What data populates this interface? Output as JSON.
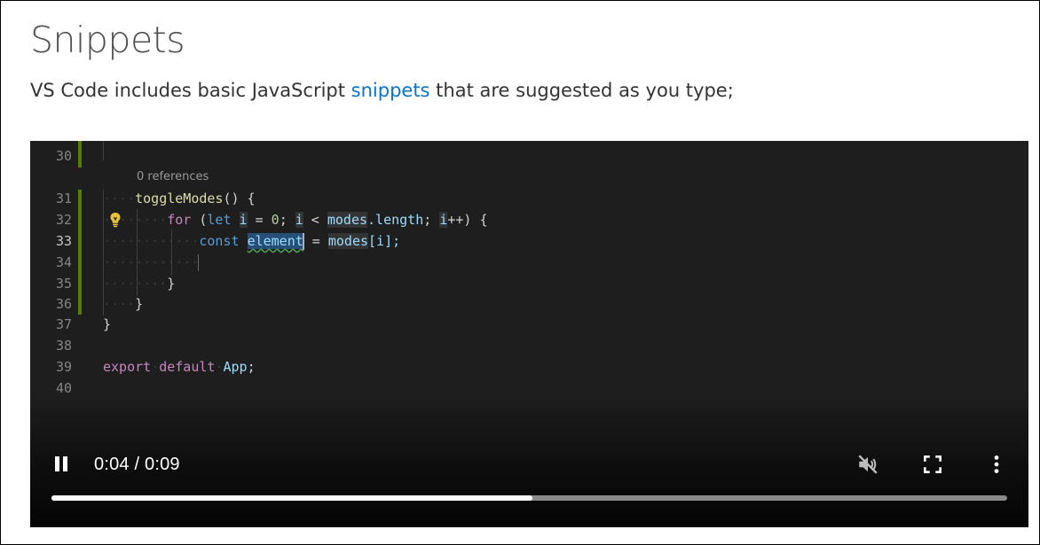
{
  "page": {
    "title": "Snippets",
    "intro_before": "VS Code includes basic JavaScript ",
    "intro_link": "snippets",
    "intro_after": " that are suggested as you type;"
  },
  "editor": {
    "codelens": "0 references",
    "line_numbers": [
      "30",
      "31",
      "32",
      "33",
      "34",
      "35",
      "36",
      "37",
      "38",
      "39",
      "40"
    ],
    "code": {
      "l31_fn": "toggleModes",
      "l31_rest": "() {",
      "l32_for": "for",
      "l32_let": "let",
      "l32_i1": "i",
      "l32_eq": " = ",
      "l32_zero": "0",
      "l32_semi1": "; ",
      "l32_i2": "i",
      "l32_lt": " < ",
      "l32_modes": "modes",
      "l32_len": ".length",
      "l32_semi2": "; ",
      "l32_i3": "i",
      "l32_inc": "++) {",
      "l33_const": "const",
      "l33_element": "element",
      "l33_eq": " = ",
      "l33_modes": "modes",
      "l33_idx": "[i];",
      "l35_close": "}",
      "l36_close": "}",
      "l37_close": "}",
      "l39_export": "export",
      "l39_default": "default",
      "l39_app": "App",
      "l39_semi": ";"
    }
  },
  "player": {
    "time": "0:04 / 0:09",
    "progress_fraction": 0.503,
    "icons": {
      "play_state": "pause-icon",
      "mute": "muted-speaker-icon",
      "fullscreen": "fullscreen-icon",
      "more": "more-vertical-icon"
    }
  }
}
